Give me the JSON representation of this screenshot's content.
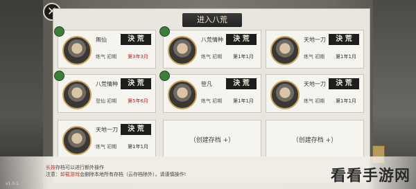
{
  "dialog": {
    "title": "进入八荒",
    "close_icon": "close-icon"
  },
  "slots": [
    {
      "name": "無仙",
      "stage": "练气 初期",
      "date": "第3年3月",
      "date_color": "red",
      "badge": "決 荒",
      "has_leaf": true
    },
    {
      "name": "八荒情种",
      "stage": "练气 初期",
      "date": "第1年1月",
      "date_color": "dark",
      "badge": "決 荒",
      "has_leaf": true
    },
    {
      "name": "天地一刀",
      "stage": "练气 初期",
      "date": "第1年1月",
      "date_color": "dark",
      "badge": "決 荒",
      "has_leaf": false
    },
    {
      "name": "八荒情种",
      "stage": "登仙 初期",
      "date": "第5年6月",
      "date_color": "red",
      "badge": "決 荒",
      "has_leaf": true
    },
    {
      "name": "笹凡",
      "stage": "练气 初期",
      "date": "第1年1月",
      "date_color": "dark",
      "badge": "決 荒",
      "has_leaf": true
    },
    {
      "name": "天地一刀",
      "stage": "练气 初期",
      "date": "第1年1月",
      "date_color": "dark",
      "badge": "決 荒",
      "has_leaf": false
    },
    {
      "name": "天地一刀",
      "stage": "练气 初期",
      "date": "第1年1月",
      "date_color": "dark",
      "badge": "決 荒",
      "has_leaf": false
    }
  ],
  "empty_slots": [
    "（创建存档 +）",
    "（创建存档 +）"
  ],
  "notice": {
    "line1_highlight": "长按",
    "line1_rest": "存档可以进行额外操作",
    "line2_prefix": "注意：",
    "line2_highlight": "卸载游戏",
    "line2_rest": "会删除本地所有存档（云存档除外），请谨慎操作!"
  },
  "watermark": "看看手游网",
  "side_label": "v1.0.1"
}
